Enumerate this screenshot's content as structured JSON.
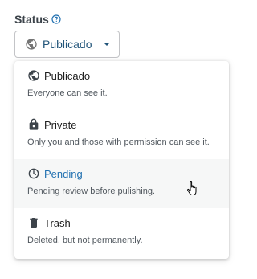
{
  "status": {
    "label": "Status",
    "help_icon": "question-circle-icon"
  },
  "dropdown": {
    "selected": "Publicado",
    "icon": "globe-icon",
    "caret_icon": "caret-down-icon",
    "accent_color": "#22557a"
  },
  "options": [
    {
      "icon": "globe-icon",
      "title": "Publicado",
      "description": "Everyone can see it."
    },
    {
      "icon": "lock-icon",
      "title": "Private",
      "description": "Only you and those with permission can see it."
    },
    {
      "icon": "clock-icon",
      "title": "Pending",
      "description": "Pending review before pulishing.",
      "hovered": true
    },
    {
      "icon": "trash-icon",
      "title": "Trash",
      "description": "Deleted, but not permanently."
    }
  ],
  "colors": {
    "hover_background": "#f6f7f7",
    "hover_title": "#2271b1"
  }
}
